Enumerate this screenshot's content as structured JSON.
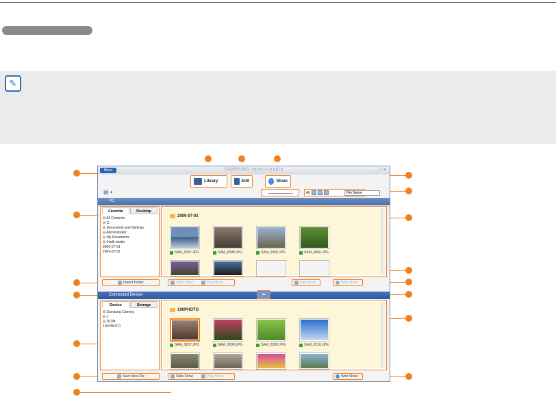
{
  "app": {
    "title": "SAMSUNG Intelli-studio",
    "menu_label": "Menu",
    "window_controls": "_ □ ✕"
  },
  "modes": {
    "library": "Library",
    "edit": "Edit",
    "share": "Share"
  },
  "toolbar": {
    "sort_value": "File Name",
    "view_all": "All"
  },
  "pc_panel": {
    "title": "PC",
    "tabs": [
      "Favorite",
      "Desktop"
    ],
    "tree": [
      "⊟ All Contents",
      "  ⊟ C:",
      "    ⊟ Documents and Settings",
      "      ⊟ Administrator",
      "        ⊟ My Documents",
      "          ⊟ Intelli-studio",
      "              2009-07-01",
      "              2009-07-02"
    ],
    "folder": "2009-07-01",
    "files": [
      "SAM_0397.JPG",
      "SAM_0398.JPG",
      "SAM_0399.JPG",
      "SAM_0400.JPG"
    ],
    "buttons": {
      "import": "Import Folder",
      "slide_show": "Slide Show",
      "play_movie": "Play Movie",
      "edit_movie": "Edit Movie",
      "web_share": "Web Share"
    }
  },
  "device_panel": {
    "title": "Connected Device",
    "tabs": [
      "Device",
      "Storage"
    ],
    "tree": [
      "⊟ Samsung Camera",
      "  ⊟ J:",
      "    ⊟ DCIM",
      "        100PHOTO"
    ],
    "folder": "100PHOTO",
    "files": [
      "SAM_0207.JPG",
      "SAM_0208.JPG",
      "SAM_0209.JPG",
      "SAM_0210.JPG"
    ],
    "buttons": {
      "save": "Save New File",
      "slide_show": "Slide Show",
      "play_movie": "Play Movie",
      "web_share": "Web Share"
    }
  }
}
